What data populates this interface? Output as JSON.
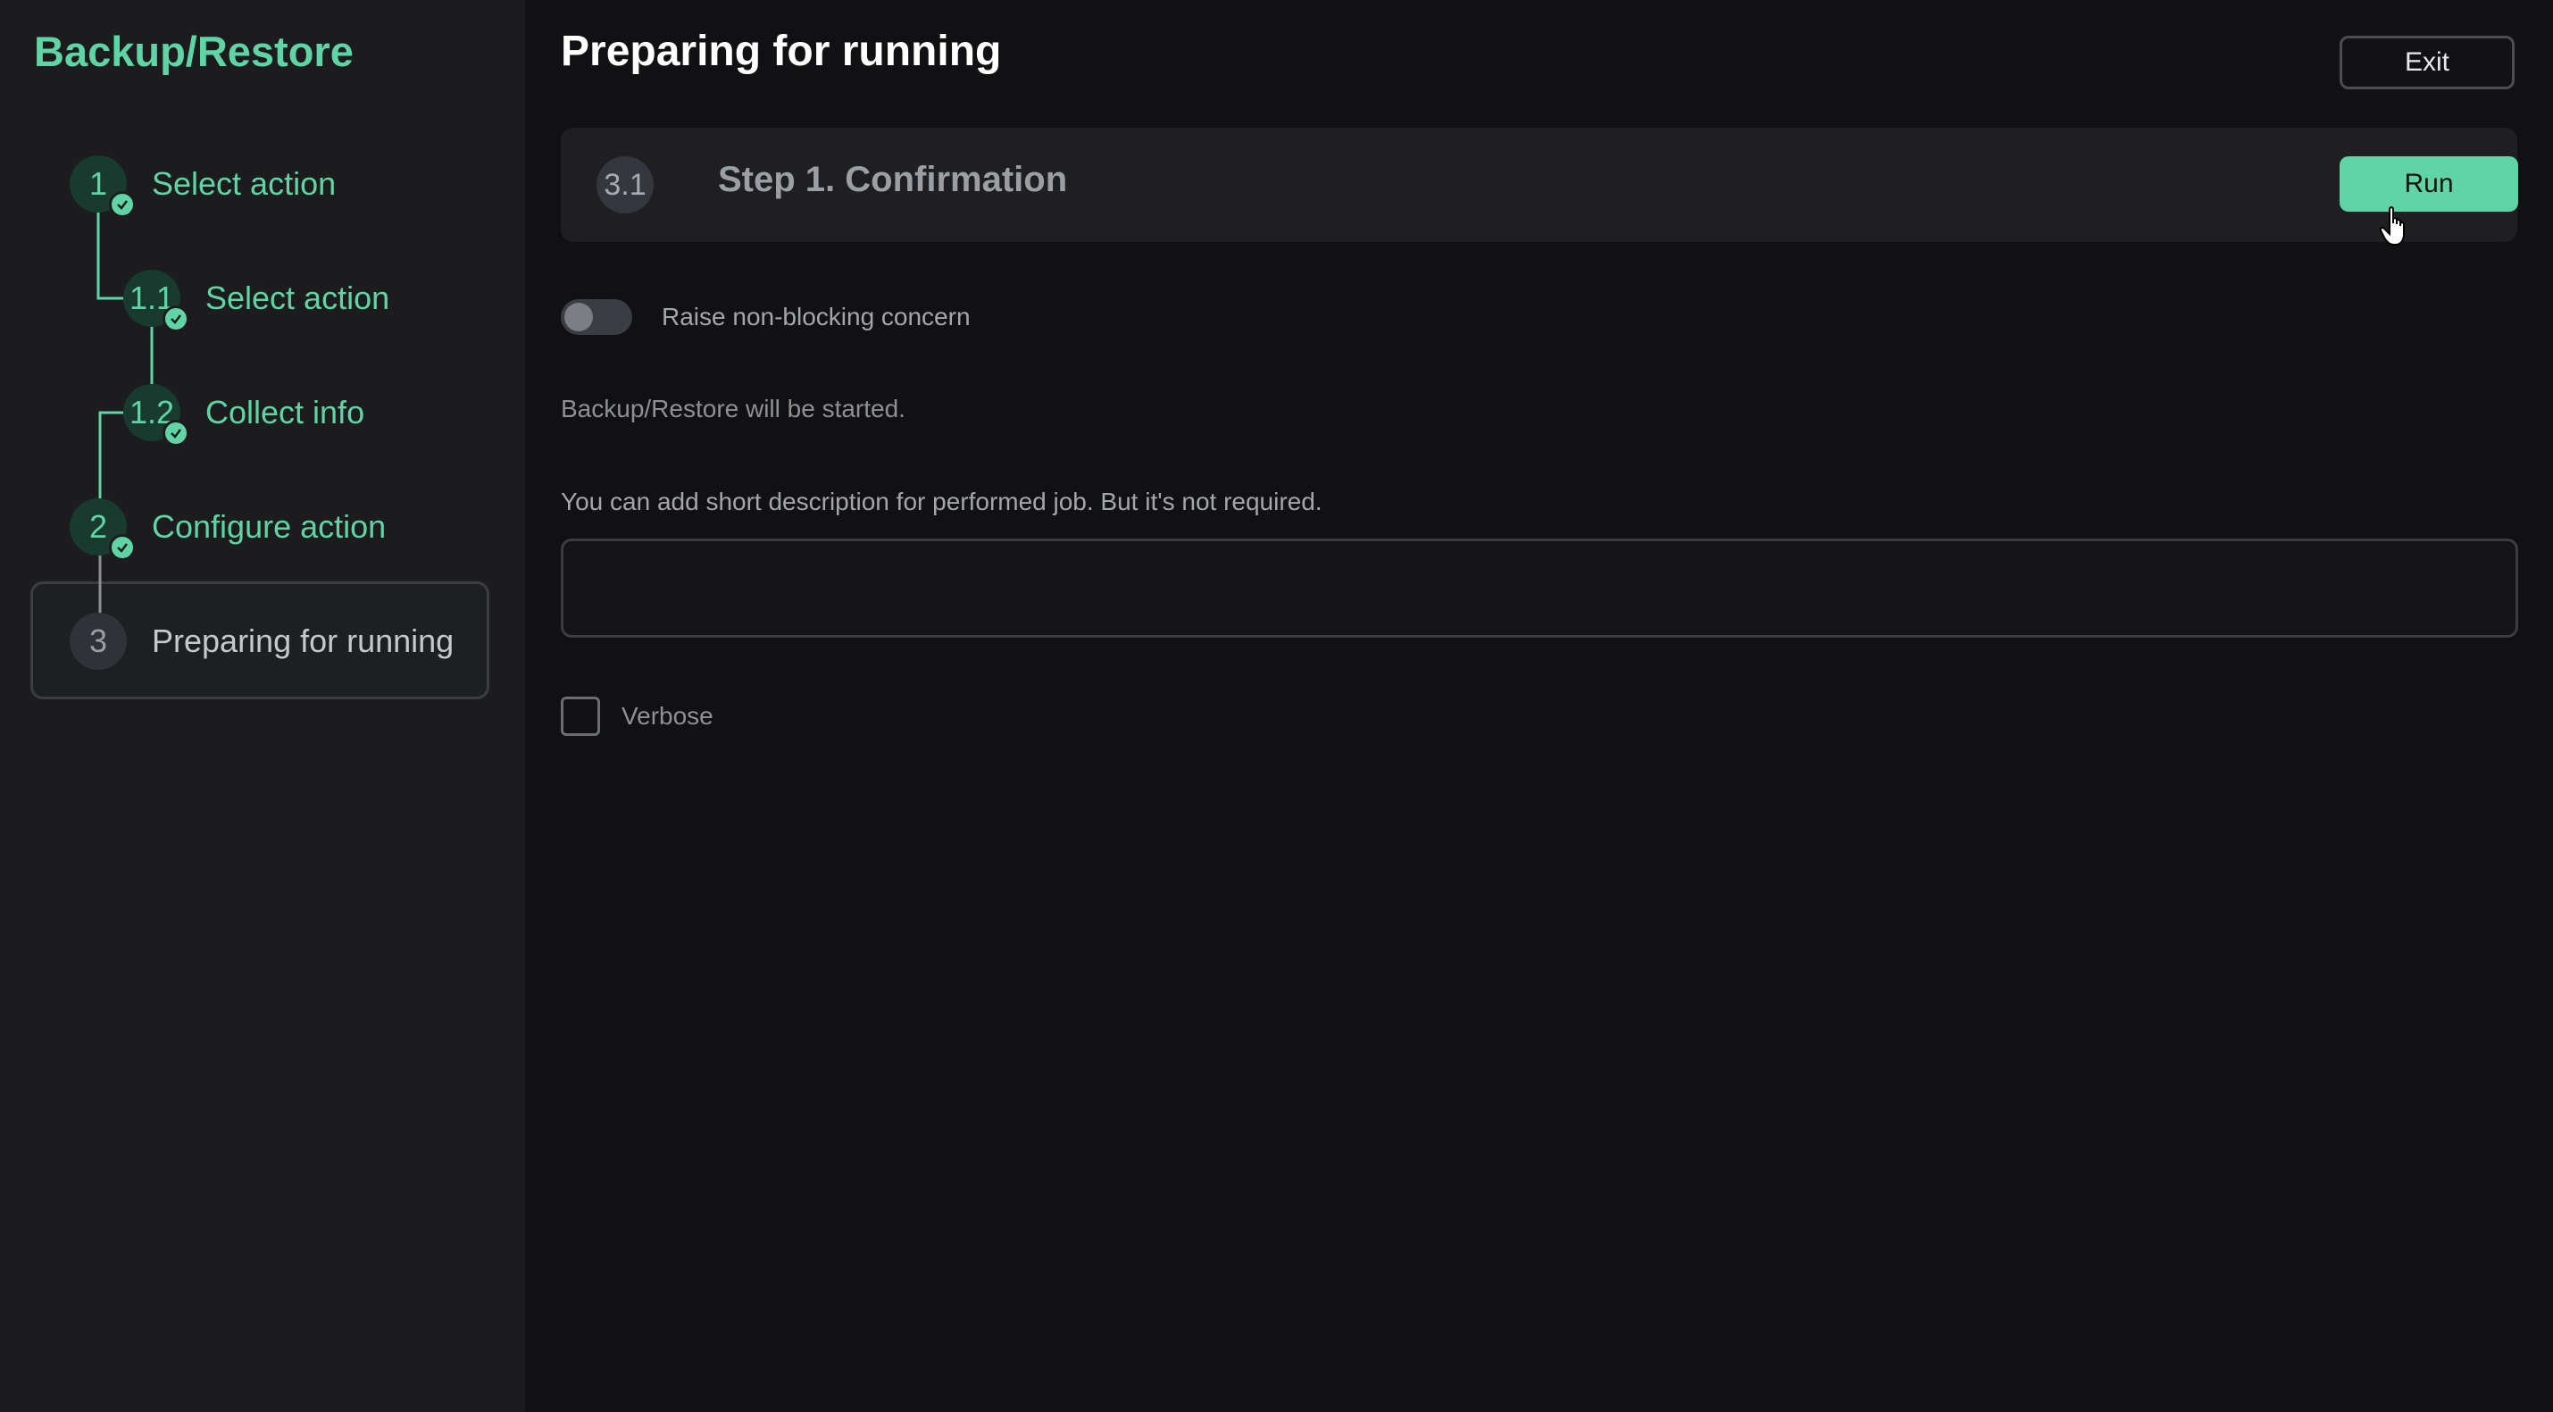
{
  "sidebar": {
    "title": "Backup/Restore",
    "steps": [
      {
        "number": "1",
        "label": "Select action",
        "status": "completed"
      },
      {
        "number": "1.1",
        "label": "Select action",
        "status": "completed"
      },
      {
        "number": "1.2",
        "label": "Collect info",
        "status": "completed"
      },
      {
        "number": "2",
        "label": "Configure action",
        "status": "completed"
      },
      {
        "number": "3",
        "label": "Preparing for running",
        "status": "current"
      }
    ]
  },
  "header": {
    "title": "Preparing for running",
    "exit_label": "Exit"
  },
  "step_card": {
    "number": "3.1",
    "title": "Step 1. Confirmation",
    "run_label": "Run"
  },
  "form": {
    "toggle_label": "Raise non-blocking concern",
    "toggle_on": false,
    "info_text": "Backup/Restore will be started.",
    "description_label": "You can add short description for performed job. But it's not required.",
    "description_value": "",
    "verbose_label": "Verbose",
    "verbose_checked": false
  },
  "colors": {
    "accent": "#5fd4a4",
    "background": "#111113",
    "sidebar": "#1c1c1f"
  }
}
